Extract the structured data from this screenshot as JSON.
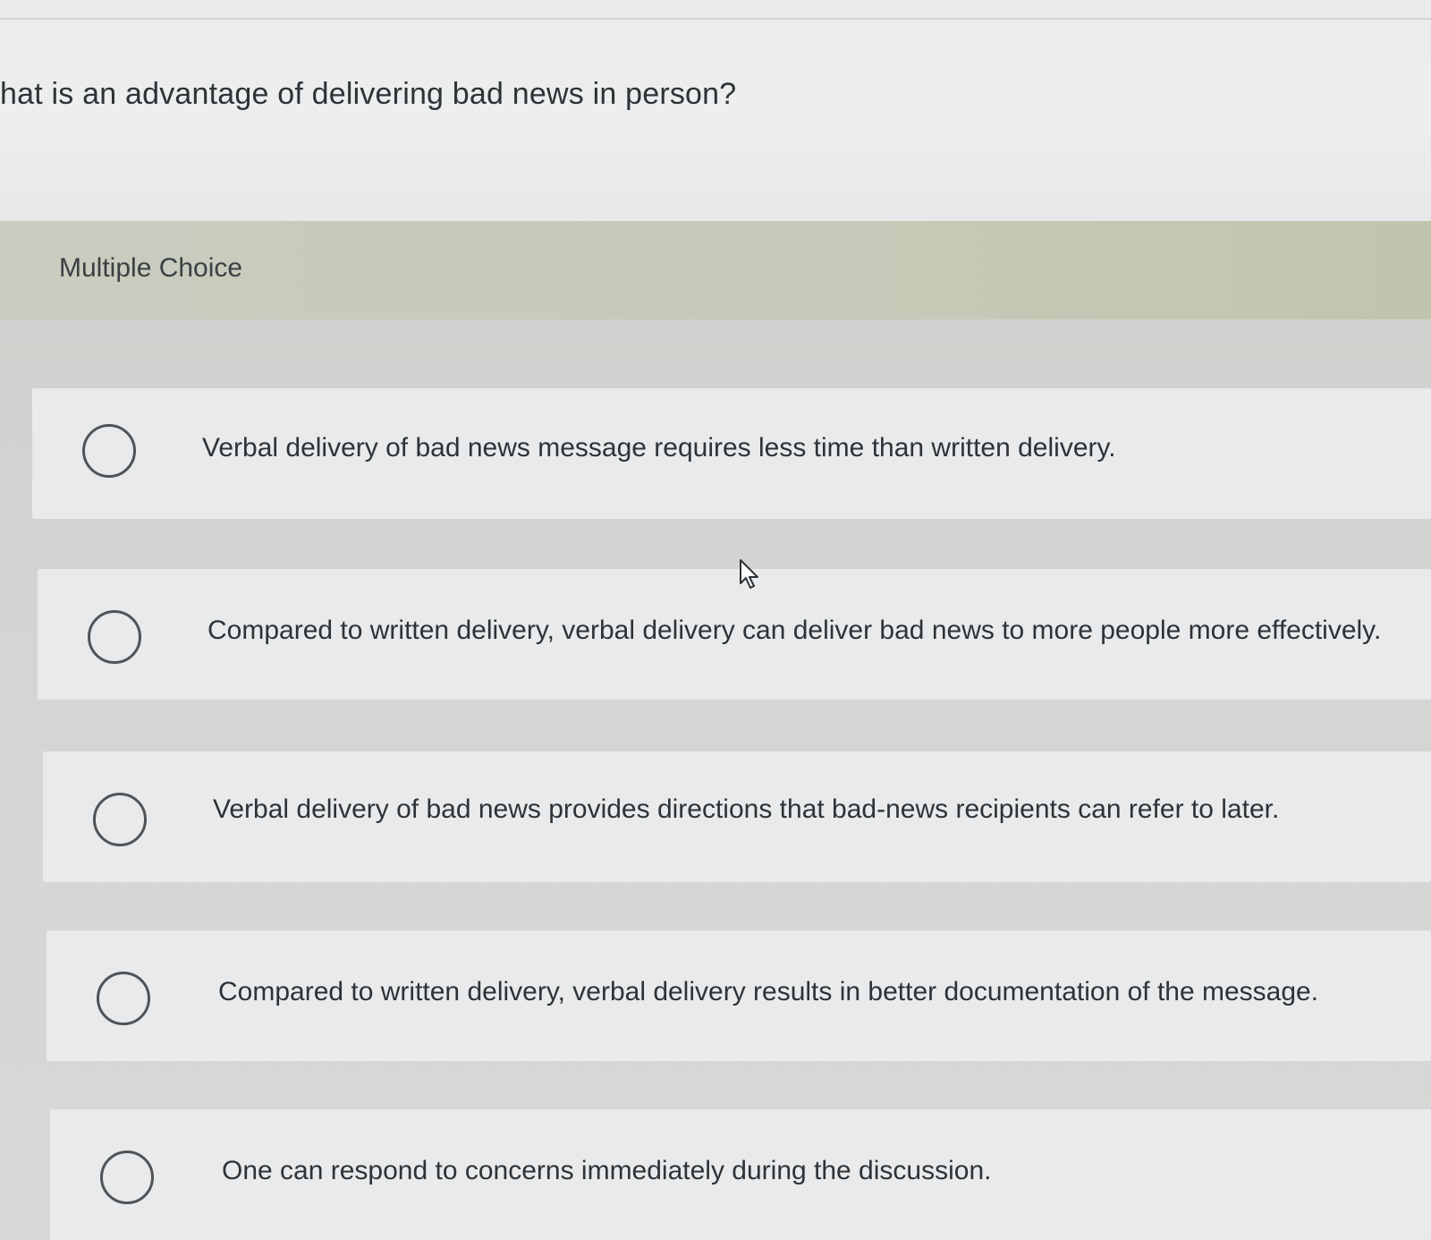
{
  "question": {
    "text": "hat is an advantage of delivering bad news in person?"
  },
  "question_type": {
    "label": "Multiple Choice"
  },
  "choices": [
    {
      "label": "Verbal delivery of bad news message requires less time than written delivery."
    },
    {
      "label": "Compared to written delivery, verbal delivery can deliver bad news to more people more effectively."
    },
    {
      "label": "Verbal delivery of bad news provides directions that bad-news recipients can refer to later."
    },
    {
      "label": "Compared to written delivery, verbal delivery results in better documentation of the message."
    },
    {
      "label": "One can respond to concerns immediately during the discussion."
    }
  ],
  "cursor": {
    "icon": "mouse-pointer-icon"
  }
}
